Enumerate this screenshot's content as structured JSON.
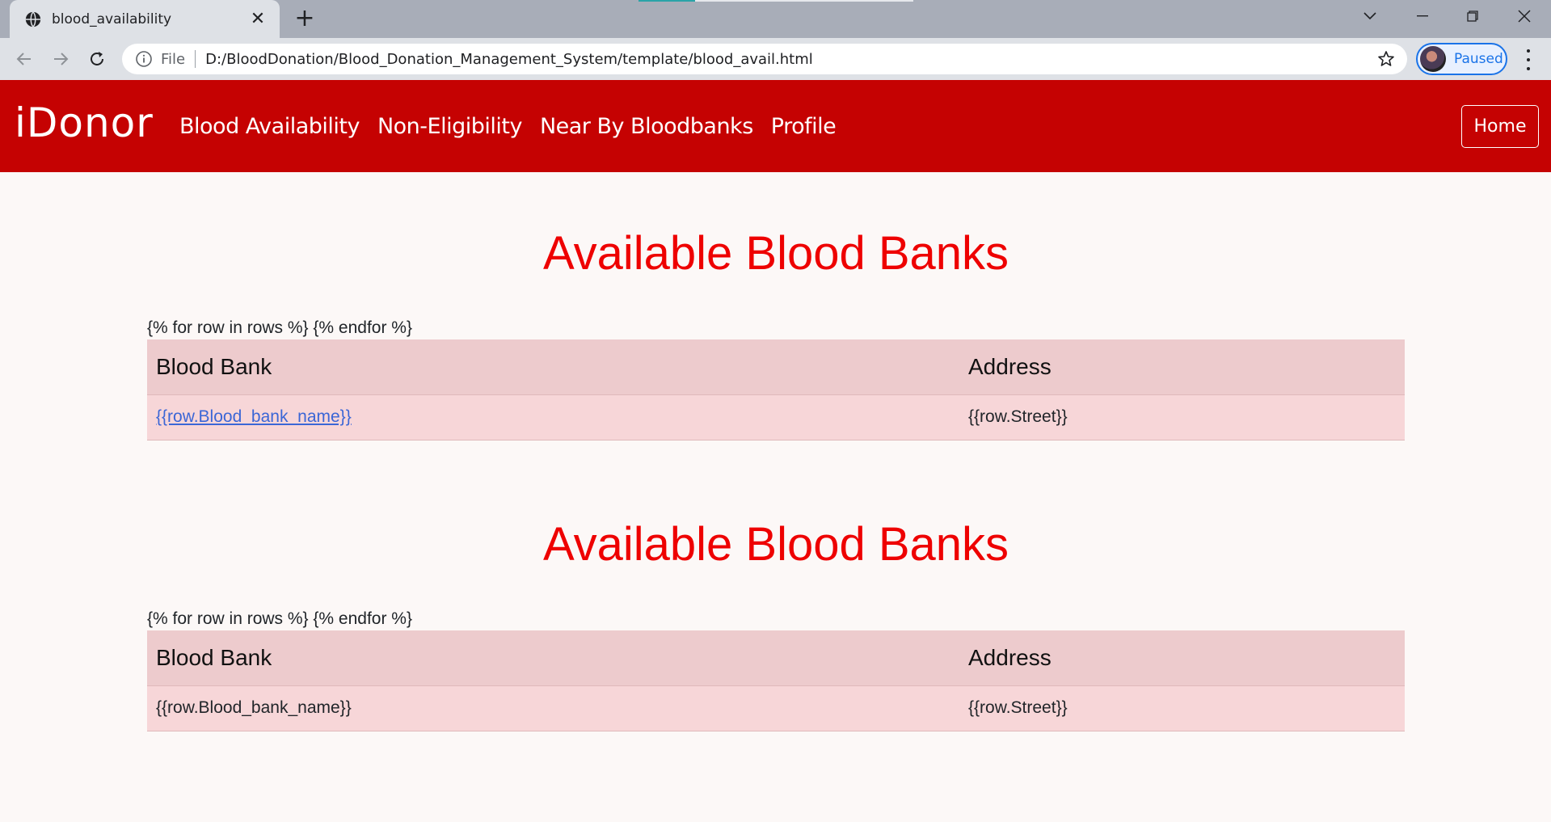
{
  "browser": {
    "tab_title": "blood_availability",
    "tab_close": "✕",
    "new_tab": "+",
    "url_scheme": "File",
    "url": "D:/BloodDonation/Blood_Donation_Management_System/template/blood_avail.html",
    "profile_status": "Paused",
    "accent_color": "#1a73e8"
  },
  "navbar": {
    "brand": "iDonor",
    "links": [
      "Blood Availability",
      "Non-Eligibility",
      "Near By Bloodbanks",
      "Profile"
    ],
    "home_button": "Home",
    "background": "#c50202"
  },
  "sections": [
    {
      "heading": "Available Blood Banks",
      "template_text": "{% for row in rows %} {% endfor %}",
      "columns": [
        "Blood Bank",
        "Address"
      ],
      "row": {
        "blood_bank": "{{row.Blood_bank_name}}",
        "address": "{{row.Street}}"
      },
      "blood_bank_is_link": true
    },
    {
      "heading": "Available Blood Banks",
      "template_text": "{% for row in rows %} {% endfor %}",
      "columns": [
        "Blood Bank",
        "Address"
      ],
      "row": {
        "blood_bank": "{{row.Blood_bank_name}}",
        "address": "{{row.Street}}"
      },
      "blood_bank_is_link": false
    }
  ],
  "colors": {
    "heading": "#ee0000",
    "table_header": "#edcbcd",
    "table_row": "#f7d6d8",
    "link": "#3b66d6"
  }
}
